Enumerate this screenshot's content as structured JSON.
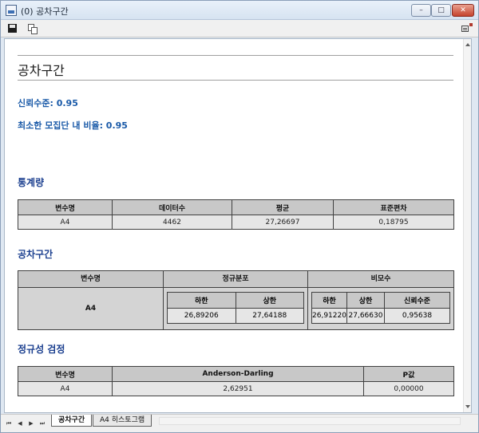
{
  "window": {
    "title": "(0) 공차구간",
    "min_glyph": "–",
    "max_glyph": "□",
    "close_glyph": "✕"
  },
  "toolbar": {
    "save_icon": "save-icon",
    "copy_icon": "copy-icon",
    "menu_icon": "options-menu-icon"
  },
  "report": {
    "title": "공차구간",
    "confidence_level": "신뢰수준: 0.95",
    "min_population_ratio": "최소한 모집단 내 비율: 0.95"
  },
  "statistics": {
    "heading": "통계량",
    "headers": [
      "변수명",
      "데이터수",
      "평균",
      "표준편차"
    ],
    "row": [
      "A4",
      "4462",
      "27,26697",
      "0,18795"
    ]
  },
  "tolerance": {
    "heading": "공차구간",
    "var_header": "변수명",
    "normal_header": "정규분포",
    "nonparam_header": "비모수",
    "variable": "A4",
    "normal": {
      "headers": [
        "하한",
        "상한"
      ],
      "values": [
        "26,89206",
        "27,64188"
      ]
    },
    "nonparam": {
      "headers": [
        "하한",
        "상한",
        "신뢰수준"
      ],
      "values": [
        "26,91220",
        "27,66630",
        "0,95638"
      ]
    }
  },
  "normality": {
    "heading": "정규성 검정",
    "headers": [
      "변수명",
      "Anderson-Darling",
      "P값"
    ],
    "row": [
      "A4",
      "2,62951",
      "0,00000"
    ]
  },
  "sheets": {
    "nav": [
      "⏮",
      "◀",
      "▶",
      "⏭"
    ],
    "tabs": [
      "공차구간",
      "A4 히스토그램"
    ]
  }
}
